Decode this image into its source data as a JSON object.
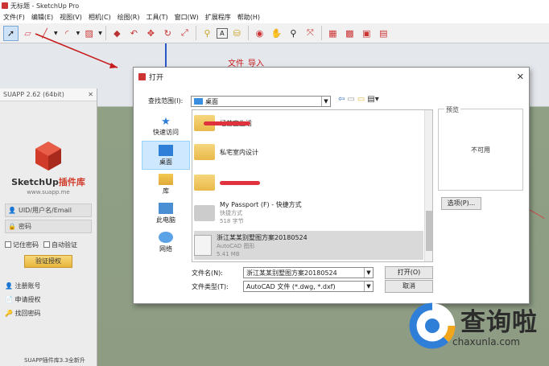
{
  "window": {
    "title": "无标题 - SketchUp Pro"
  },
  "menu": [
    "文件(F)",
    "编辑(E)",
    "视图(V)",
    "相机(C)",
    "绘图(R)",
    "工具(T)",
    "窗口(W)",
    "扩展程序",
    "帮助(H)"
  ],
  "toolbar": {
    "icons": [
      "select-icon",
      "eraser-icon",
      "line-icon",
      "arc-icon",
      "rectangle-icon",
      "push-pull-icon",
      "follow-me-icon",
      "move-icon",
      "rotate-icon",
      "scale-icon",
      "tape-measure-icon",
      "text-icon",
      "paint-bucket-icon",
      "orbit-icon",
      "pan-icon",
      "zoom-icon",
      "zoom-extents-icon",
      "warehouse-icon",
      "extension-warehouse-icon",
      "layout-icon",
      "send-icon"
    ]
  },
  "annotation": {
    "text": "文件_导入"
  },
  "suapp": {
    "title": "SUAPP 2.62 (64bit)",
    "brand_main": "SketchUp",
    "brand_accent": "插件库",
    "url": "www.suapp.me",
    "uid_placeholder": "UID/用户名/Email",
    "password_placeholder": "密码",
    "remember": "记住密码",
    "auto_verify": "自动验证",
    "verify_button": "验证授权",
    "links": [
      "注册账号",
      "申请授权",
      "找回密码"
    ],
    "footer": "SUAPP插件库3.3全新升"
  },
  "dialog": {
    "title": "打开",
    "look_in_label": "查找范围(I):",
    "look_in_value": "桌面",
    "places": [
      "快速访问",
      "桌面",
      "库",
      "此电脑",
      "网络"
    ],
    "files": [
      {
        "name": "经营宝生活",
        "sub": ""
      },
      {
        "name": "私宅室内设计",
        "sub": ""
      },
      {
        "name": "",
        "sub": ""
      },
      {
        "name": "My Passport (F) - 快捷方式",
        "sub1": "快捷方式",
        "sub2": "518 字节"
      },
      {
        "name": "浙江某某别墅图方案20180524",
        "sub1": "AutoCAD 图形",
        "sub2": "5.41 MB"
      }
    ],
    "preview_label": "预览",
    "preview_text": "不可用",
    "options_button": "选项(P)...",
    "filename_label": "文件名(N):",
    "filename_value": "浙江某某别墅图方案20180524",
    "filetype_label": "文件类型(T):",
    "filetype_value": "AutoCAD 文件 (*.dwg, *.dxf)",
    "open_button": "打开(O)",
    "cancel_button": "取消"
  },
  "watermark": {
    "text": "查询啦",
    "url": "chaxunla.com"
  },
  "colors": {
    "accent_red": "#d13b2a",
    "selection": "#cde8ff",
    "folder": "#e9b949"
  }
}
